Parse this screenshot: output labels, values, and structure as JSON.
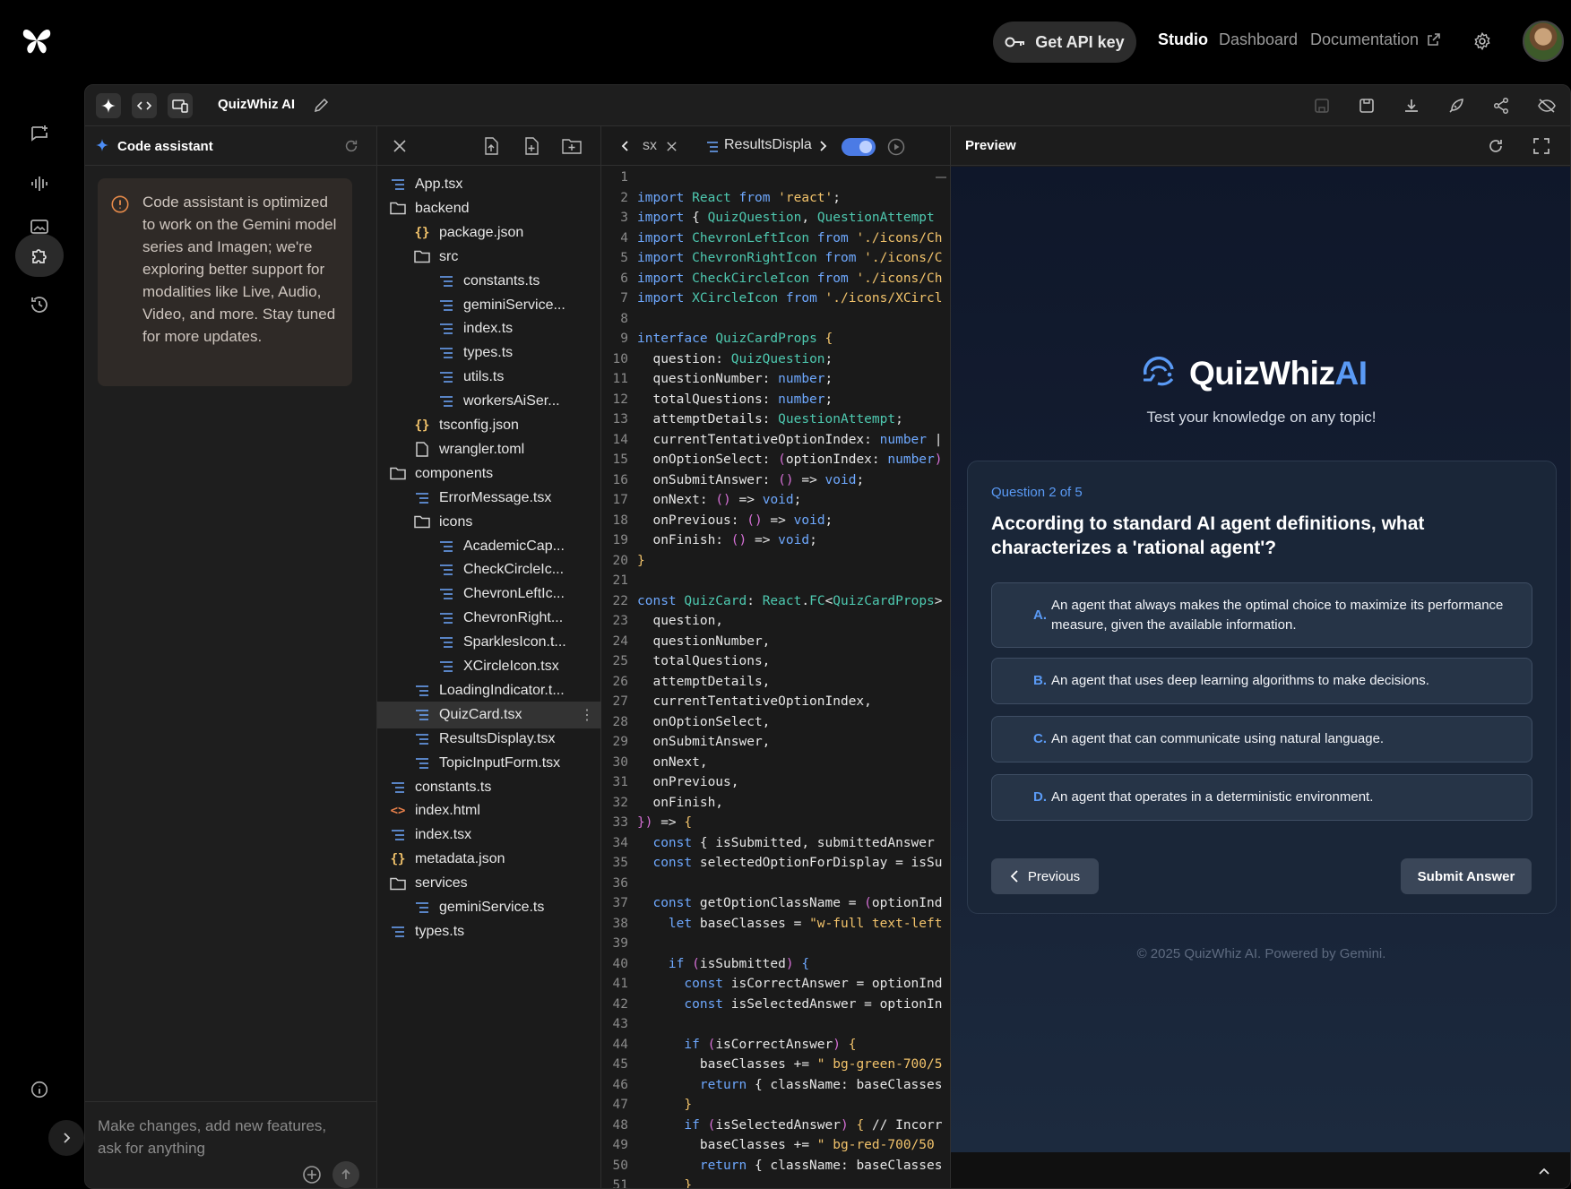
{
  "topbar": {
    "api_key_label": "Get API key",
    "studio": "Studio",
    "dashboard": "Dashboard",
    "documentation": "Documentation"
  },
  "toolbar": {
    "project_name": "QuizWhiz AI"
  },
  "assistant": {
    "title": "Code assistant",
    "notice": "Code assistant is optimized to work on the Gemini model series and Imagen; we're exploring better support for modalities like Live, Audio, Video, and more. Stay tuned for more updates.",
    "input_placeholder": "Make changes, add new features, ask for anything"
  },
  "files": [
    {
      "name": "App.tsx",
      "kind": "file",
      "depth": 0
    },
    {
      "name": "backend",
      "kind": "folder",
      "depth": 0
    },
    {
      "name": "package.json",
      "kind": "json",
      "depth": 1
    },
    {
      "name": "src",
      "kind": "folder",
      "depth": 1
    },
    {
      "name": "constants.ts",
      "kind": "file",
      "depth": 2
    },
    {
      "name": "geminiService...",
      "kind": "file",
      "depth": 2
    },
    {
      "name": "index.ts",
      "kind": "file",
      "depth": 2
    },
    {
      "name": "types.ts",
      "kind": "file",
      "depth": 2
    },
    {
      "name": "utils.ts",
      "kind": "file",
      "depth": 2
    },
    {
      "name": "workersAiSer...",
      "kind": "file",
      "depth": 2
    },
    {
      "name": "tsconfig.json",
      "kind": "json",
      "depth": 1
    },
    {
      "name": "wrangler.toml",
      "kind": "doc",
      "depth": 1
    },
    {
      "name": "components",
      "kind": "folder",
      "depth": 0
    },
    {
      "name": "ErrorMessage.tsx",
      "kind": "file",
      "depth": 1
    },
    {
      "name": "icons",
      "kind": "folder",
      "depth": 1
    },
    {
      "name": "AcademicCap...",
      "kind": "file",
      "depth": 2
    },
    {
      "name": "CheckCircleIc...",
      "kind": "file",
      "depth": 2
    },
    {
      "name": "ChevronLeftIc...",
      "kind": "file",
      "depth": 2
    },
    {
      "name": "ChevronRight...",
      "kind": "file",
      "depth": 2
    },
    {
      "name": "SparklesIcon.t...",
      "kind": "file",
      "depth": 2
    },
    {
      "name": "XCircleIcon.tsx",
      "kind": "file",
      "depth": 2
    },
    {
      "name": "LoadingIndicator.t...",
      "kind": "file",
      "depth": 1
    },
    {
      "name": "QuizCard.tsx",
      "kind": "file",
      "depth": 1,
      "selected": true
    },
    {
      "name": "ResultsDisplay.tsx",
      "kind": "file",
      "depth": 1
    },
    {
      "name": "TopicInputForm.tsx",
      "kind": "file",
      "depth": 1
    },
    {
      "name": "constants.ts",
      "kind": "file",
      "depth": 0
    },
    {
      "name": "index.html",
      "kind": "html",
      "depth": 0
    },
    {
      "name": "index.tsx",
      "kind": "file",
      "depth": 0
    },
    {
      "name": "metadata.json",
      "kind": "json",
      "depth": 0
    },
    {
      "name": "services",
      "kind": "folder",
      "depth": 0
    },
    {
      "name": "geminiService.ts",
      "kind": "file",
      "depth": 1
    },
    {
      "name": "types.ts",
      "kind": "file",
      "depth": 0
    }
  ],
  "editor": {
    "tab_prev_fragment": "sx",
    "tab_active": "ResultsDispla",
    "lines": [
      [
        [
          "",
          ""
        ]
      ],
      [
        [
          "kw",
          "import "
        ],
        [
          "ty",
          "React "
        ],
        [
          "kw",
          "from "
        ],
        [
          "str",
          "'react'"
        ],
        [
          "fn",
          ";"
        ]
      ],
      [
        [
          "kw",
          "import "
        ],
        [
          "fn",
          "{ "
        ],
        [
          "ty",
          "QuizQuestion"
        ],
        [
          "fn",
          ", "
        ],
        [
          "ty",
          "QuestionAttempt"
        ]
      ],
      [
        [
          "kw",
          "import "
        ],
        [
          "ty",
          "ChevronLeftIcon "
        ],
        [
          "kw",
          "from "
        ],
        [
          "str",
          "'./icons/Ch"
        ]
      ],
      [
        [
          "kw",
          "import "
        ],
        [
          "ty",
          "ChevronRightIcon "
        ],
        [
          "kw",
          "from "
        ],
        [
          "str",
          "'./icons/C"
        ]
      ],
      [
        [
          "kw",
          "import "
        ],
        [
          "ty",
          "CheckCircleIcon "
        ],
        [
          "kw",
          "from "
        ],
        [
          "str",
          "'./icons/Ch"
        ]
      ],
      [
        [
          "kw",
          "import "
        ],
        [
          "ty",
          "XCircleIcon "
        ],
        [
          "kw",
          "from "
        ],
        [
          "str",
          "'./icons/XCircl"
        ]
      ],
      [
        [
          "",
          ""
        ]
      ],
      [
        [
          "kw",
          "interface "
        ],
        [
          "ty",
          "QuizCardProps "
        ],
        [
          "str",
          "{"
        ]
      ],
      [
        [
          "fn",
          "  question: "
        ],
        [
          "ty",
          "QuizQuestion"
        ],
        [
          "fn",
          ";"
        ]
      ],
      [
        [
          "fn",
          "  questionNumber: "
        ],
        [
          "kw",
          "number"
        ],
        [
          "fn",
          ";"
        ]
      ],
      [
        [
          "fn",
          "  totalQuestions: "
        ],
        [
          "kw",
          "number"
        ],
        [
          "fn",
          ";"
        ]
      ],
      [
        [
          "fn",
          "  attemptDetails: "
        ],
        [
          "ty",
          "QuestionAttempt"
        ],
        [
          "fn",
          ";"
        ]
      ],
      [
        [
          "fn",
          "  currentTentativeOptionIndex: "
        ],
        [
          "kw",
          "number "
        ],
        [
          "fn",
          "|"
        ]
      ],
      [
        [
          "fn",
          "  onOptionSelect: "
        ],
        [
          "pu",
          "("
        ],
        [
          "fn",
          "optionIndex: "
        ],
        [
          "kw",
          "number"
        ],
        [
          "pu",
          ")"
        ]
      ],
      [
        [
          "fn",
          "  onSubmitAnswer: "
        ],
        [
          "pu",
          "() "
        ],
        [
          "fn",
          "=> "
        ],
        [
          "kw",
          "void"
        ],
        [
          "fn",
          ";"
        ]
      ],
      [
        [
          "fn",
          "  onNext: "
        ],
        [
          "pu",
          "() "
        ],
        [
          "fn",
          "=> "
        ],
        [
          "kw",
          "void"
        ],
        [
          "fn",
          ";"
        ]
      ],
      [
        [
          "fn",
          "  onPrevious: "
        ],
        [
          "pu",
          "() "
        ],
        [
          "fn",
          "=> "
        ],
        [
          "kw",
          "void"
        ],
        [
          "fn",
          ";"
        ]
      ],
      [
        [
          "fn",
          "  onFinish: "
        ],
        [
          "pu",
          "() "
        ],
        [
          "fn",
          "=> "
        ],
        [
          "kw",
          "void"
        ],
        [
          "fn",
          ";"
        ]
      ],
      [
        [
          "str",
          "}"
        ]
      ],
      [
        [
          "",
          ""
        ]
      ],
      [
        [
          "kw",
          "const "
        ],
        [
          "ty",
          "QuizCard"
        ],
        [
          "fn",
          ": "
        ],
        [
          "ty",
          "React"
        ],
        [
          "fn",
          "."
        ],
        [
          "ty",
          "FC"
        ],
        [
          "fn",
          "<"
        ],
        [
          "ty",
          "QuizCardProps"
        ],
        [
          "fn",
          ">"
        ]
      ],
      [
        [
          "fn",
          "  question,"
        ]
      ],
      [
        [
          "fn",
          "  questionNumber,"
        ]
      ],
      [
        [
          "fn",
          "  totalQuestions,"
        ]
      ],
      [
        [
          "fn",
          "  attemptDetails,"
        ]
      ],
      [
        [
          "fn",
          "  currentTentativeOptionIndex,"
        ]
      ],
      [
        [
          "fn",
          "  onOptionSelect,"
        ]
      ],
      [
        [
          "fn",
          "  onSubmitAnswer,"
        ]
      ],
      [
        [
          "fn",
          "  onNext,"
        ]
      ],
      [
        [
          "fn",
          "  onPrevious,"
        ]
      ],
      [
        [
          "fn",
          "  onFinish,"
        ]
      ],
      [
        [
          "pu",
          "}) "
        ],
        [
          "fn",
          "=> "
        ],
        [
          "str",
          "{"
        ]
      ],
      [
        [
          "kw",
          "  const "
        ],
        [
          "fn",
          "{ isSubmitted, submittedAnswer"
        ]
      ],
      [
        [
          "kw",
          "  const "
        ],
        [
          "fn",
          "selectedOptionForDisplay = isSu"
        ]
      ],
      [
        [
          "",
          ""
        ]
      ],
      [
        [
          "kw",
          "  const "
        ],
        [
          "fn",
          "getOptionClassName = "
        ],
        [
          "pu",
          "("
        ],
        [
          "fn",
          "optionInd"
        ]
      ],
      [
        [
          "kw",
          "    let "
        ],
        [
          "fn",
          "baseClasses = "
        ],
        [
          "str",
          "\"w-full text-left"
        ]
      ],
      [
        [
          "",
          ""
        ]
      ],
      [
        [
          "kw",
          "    if "
        ],
        [
          "pu",
          "("
        ],
        [
          "fn",
          "isSubmitted"
        ],
        [
          "pu",
          ") "
        ],
        [
          "kw",
          "{"
        ]
      ],
      [
        [
          "kw",
          "      const "
        ],
        [
          "fn",
          "isCorrectAnswer = optionInd"
        ]
      ],
      [
        [
          "kw",
          "      const "
        ],
        [
          "fn",
          "isSelectedAnswer = optionIn"
        ]
      ],
      [
        [
          "",
          ""
        ]
      ],
      [
        [
          "kw",
          "      if "
        ],
        [
          "pu",
          "("
        ],
        [
          "fn",
          "isCorrectAnswer"
        ],
        [
          "pu",
          ") "
        ],
        [
          "str",
          "{"
        ]
      ],
      [
        [
          "fn",
          "        baseClasses += "
        ],
        [
          "str",
          "\" bg-green-700/5"
        ]
      ],
      [
        [
          "kw",
          "        return "
        ],
        [
          "fn",
          "{ className: baseClasses"
        ]
      ],
      [
        [
          "str",
          "      }"
        ]
      ],
      [
        [
          "kw",
          "      if "
        ],
        [
          "pu",
          "("
        ],
        [
          "fn",
          "isSelectedAnswer"
        ],
        [
          "pu",
          ") "
        ],
        [
          "str",
          "{ "
        ],
        [
          "fn",
          "// Incorr"
        ]
      ],
      [
        [
          "fn",
          "        baseClasses += "
        ],
        [
          "str",
          "\" bg-red-700/50"
        ]
      ],
      [
        [
          "kw",
          "        return "
        ],
        [
          "fn",
          "{ className: baseClasses"
        ]
      ],
      [
        [
          "str",
          "      }"
        ]
      ]
    ]
  },
  "preview": {
    "title": "Preview",
    "brand_main": "QuizWhiz",
    "brand_accent": "AI",
    "tagline": "Test your knowledge on any topic!",
    "question_counter": "Question 2 of 5",
    "question": "According to standard AI agent definitions, what characterizes a 'rational agent'?",
    "options": [
      {
        "letter": "A.",
        "text": "An agent that always makes the optimal choice to maximize its performance measure, given the available information."
      },
      {
        "letter": "B.",
        "text": "An agent that uses deep learning algorithms to make decisions."
      },
      {
        "letter": "C.",
        "text": "An agent that can communicate using natural language."
      },
      {
        "letter": "D.",
        "text": "An agent that operates in a deterministic environment."
      }
    ],
    "prev_button": "Previous",
    "submit_button": "Submit Answer",
    "footer": "© 2025 QuizWhiz AI. Powered by Gemini."
  },
  "colors": {
    "accent": "#5a9af5",
    "toggle": "#4b7be5"
  }
}
